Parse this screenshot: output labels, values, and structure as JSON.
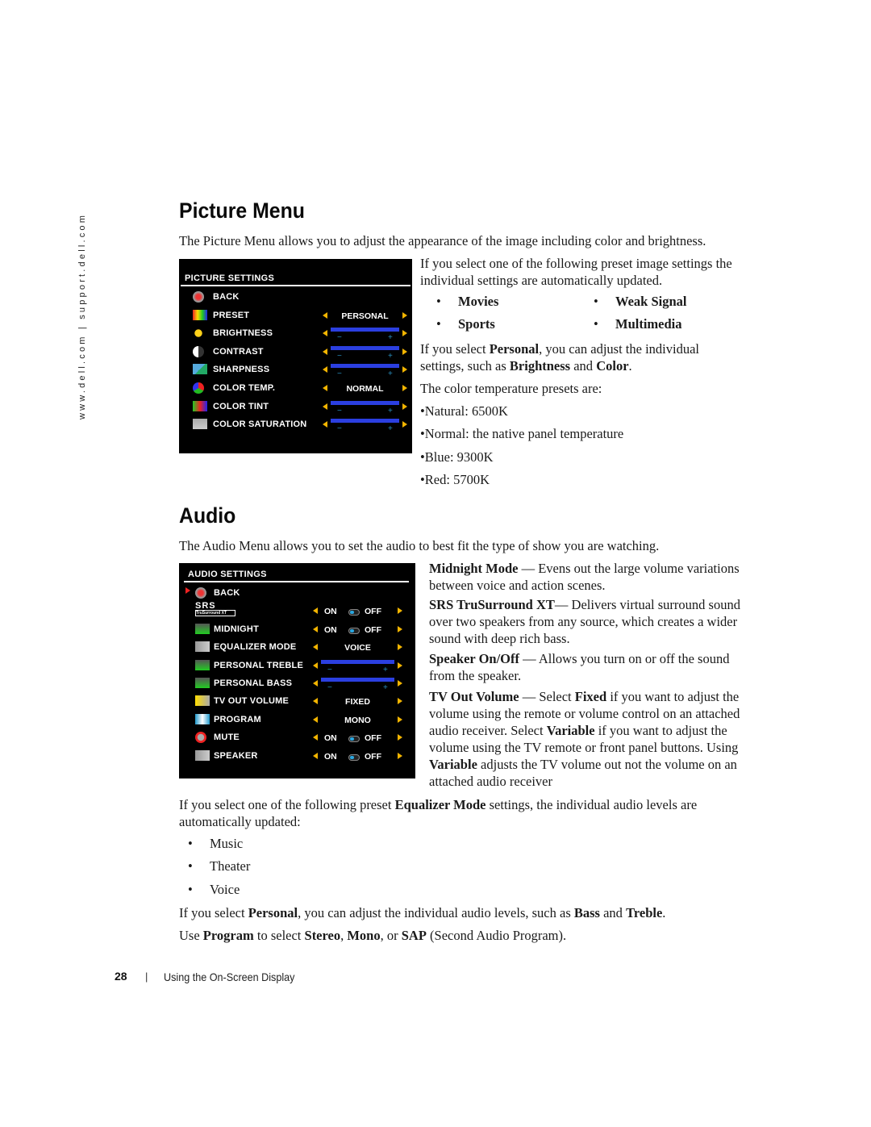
{
  "side_text": "www.dell.com | support.dell.com",
  "picture": {
    "heading": "Picture Menu",
    "intro": "The Picture Menu allows you to adjust the appearance of the image including color and brightness.",
    "osd": {
      "title": "PICTURE SETTINGS",
      "rows": [
        {
          "label": "BACK",
          "icon": "back-icon",
          "kind": "none"
        },
        {
          "label": "PRESET",
          "icon": "preset-icon",
          "kind": "value",
          "value": "PERSONAL"
        },
        {
          "label": "BRIGHTNESS",
          "icon": "brightness-icon",
          "kind": "slider",
          "level": 1.0
        },
        {
          "label": "CONTRAST",
          "icon": "contrast-icon",
          "kind": "slider",
          "level": 1.0
        },
        {
          "label": "SHARPNESS",
          "icon": "sharpness-icon",
          "kind": "slider",
          "level": 1.0
        },
        {
          "label": "COLOR TEMP.",
          "icon": "color-temp-icon",
          "kind": "value",
          "value": "NORMAL"
        },
        {
          "label": "COLOR TINT",
          "icon": "color-tint-icon",
          "kind": "slider",
          "level": 1.0
        },
        {
          "label": "COLOR SATURATION",
          "icon": "color-saturation-icon",
          "kind": "slider",
          "level": 1.0
        }
      ],
      "minus": "−",
      "plus": "+"
    },
    "preset_text": "If you select one of the following preset image settings the individual settings are automatically updated.",
    "presets": [
      "Movies",
      "Weak Signal",
      "Sports",
      "Multimedia"
    ],
    "personal_pre": "If you select ",
    "personal_b1": "Personal",
    "personal_mid": ", you can adjust the individual settings, such as ",
    "personal_b2": "Brightness",
    "personal_and": " and ",
    "personal_b3": "Color",
    "personal_end": ".",
    "temp_intro": "The color temperature presets are:",
    "temps": [
      "•Natural: 6500K",
      "•Normal: the native panel temperature",
      "•Blue: 9300K",
      "•Red: 5700K"
    ]
  },
  "audio": {
    "heading": "Audio",
    "intro": "The Audio Menu allows you to set the audio to best fit the type of show you are watching.",
    "osd": {
      "title": "AUDIO SETTINGS",
      "srs_logo": "SRS",
      "srs_sub": "TruSurround XT",
      "on": "ON",
      "off": "OFF",
      "rows": [
        {
          "label": "BACK",
          "icon": "back-icon",
          "kind": "none",
          "selected": true
        },
        {
          "label": "",
          "icon": "srs-logo-icon",
          "kind": "toggle"
        },
        {
          "label": "MIDNIGHT",
          "icon": "midnight-icon",
          "kind": "toggle"
        },
        {
          "label": "EQUALIZER MODE",
          "icon": "speaker-icon",
          "kind": "value",
          "value": "VOICE"
        },
        {
          "label": "PERSONAL TREBLE",
          "icon": "treble-icon",
          "kind": "slider",
          "level": 1.0
        },
        {
          "label": "PERSONAL BASS",
          "icon": "bass-icon",
          "kind": "slider",
          "level": 1.0
        },
        {
          "label": "TV OUT VOLUME",
          "icon": "tv-out-volume-icon",
          "kind": "value",
          "value": "FIXED"
        },
        {
          "label": "PROGRAM",
          "icon": "program-icon",
          "kind": "value",
          "value": "MONO"
        },
        {
          "label": "MUTE",
          "icon": "mute-icon",
          "kind": "toggle"
        },
        {
          "label": "SPEAKER",
          "icon": "speaker-icon",
          "kind": "toggle"
        }
      ],
      "minus": "−",
      "plus": "+"
    },
    "desc": [
      {
        "term": "Midnight Mode",
        "text": " — Evens out the large volume variations between voice and action scenes."
      },
      {
        "term": "SRS TruSurround XT",
        "text": "— Delivers virtual surround sound over two speakers from any source, which creates a wider sound with deep rich bass."
      },
      {
        "term": "Speaker On/Off",
        "text": " — Allows you turn on or off the sound from the speaker."
      }
    ],
    "tvout": {
      "term": "TV Out Volume",
      "t1": " — Select ",
      "b1": "Fixed",
      "t2": " if you want to adjust the volume using the remote or volume control on an attached audio receiver. Select ",
      "b2": "Variable",
      "t3": " if you want to adjust the volume using the TV remote or front panel buttons. Using ",
      "b3": "Variable",
      "t4": " adjusts the TV volume out not the volume on an attached audio receiver"
    },
    "eq_pre": "If you select one of the following preset ",
    "eq_b": "Equalizer Mode",
    "eq_post": " settings, the individual audio levels are automatically updated:",
    "eq_modes": [
      "Music",
      "Theater",
      "Voice"
    ],
    "pers": {
      "t1": "If you select ",
      "b1": "Personal",
      "t2": ", you can adjust the individual audio levels, such as ",
      "b2": "Bass",
      "t3": " and ",
      "b3": "Treble",
      "t4": "."
    },
    "prog": {
      "t1": "Use ",
      "b1": "Program",
      "t2": " to select ",
      "b2": "Stereo",
      "t3": ", ",
      "b3": "Mono",
      "t4": ", or ",
      "b4": "SAP",
      "t5": " (Second Audio Program)."
    }
  },
  "footer": {
    "page": "28",
    "sep": "|",
    "text": "Using the On-Screen Display"
  }
}
